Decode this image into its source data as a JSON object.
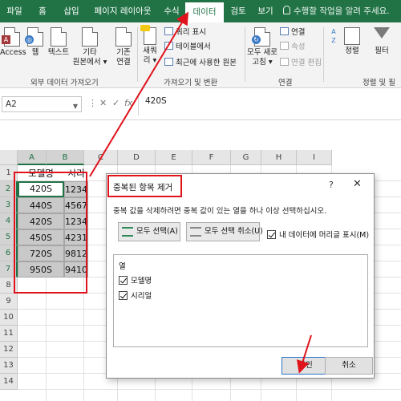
{
  "tabs": [
    "파일",
    "홈",
    "삽입",
    "페이지 레이아웃",
    "수식",
    "데이터",
    "검토",
    "보기"
  ],
  "active_tab": "데이터",
  "tell_me": "수행할 작업을 알려 주세요.",
  "ribbon": {
    "external_data": {
      "access": "Access",
      "web": "웹",
      "text": "텍스트",
      "other_line1": "기타",
      "other_line2": "원본에서 ▾",
      "existing_line1": "기존",
      "existing_line2": "연결",
      "group_label": "외부 데이터 가져오기"
    },
    "get_transform": {
      "new_query_line1": "새쿼",
      "new_query_line2": "리 ▾",
      "show_query": "쿼리 표시",
      "from_table": "테이블에서",
      "recent_sources": "최근에 사용한 원본",
      "group_label": "가져오기 및 변환"
    },
    "connections": {
      "refresh_line1": "모두 새로",
      "refresh_line2": "고침 ▾",
      "connections": "연결",
      "properties": "속성",
      "edit_links": "연결 편집",
      "group_label": "연결"
    },
    "sort_filter": {
      "sort": "정렬",
      "filter": "필터",
      "group_label": "정렬 및 필"
    }
  },
  "formula_bar": {
    "name_box": "A2",
    "cancel": "✕",
    "enter": "✓",
    "fx": "fx",
    "content": "420S"
  },
  "grid": {
    "columns": [
      "A",
      "B",
      "C",
      "D",
      "E",
      "F",
      "G",
      "H",
      "I"
    ],
    "rows": [
      "1",
      "2",
      "3",
      "4",
      "5",
      "6",
      "7",
      "8",
      "9",
      "10",
      "11",
      "12",
      "13",
      "14"
    ],
    "header": [
      "모델명",
      "시리얼"
    ],
    "data": [
      [
        "420S",
        "1234"
      ],
      [
        "440S",
        "4567"
      ],
      [
        "420S",
        "1234"
      ],
      [
        "450S",
        "4231"
      ],
      [
        "720S",
        "9812"
      ],
      [
        "950S",
        "9410"
      ]
    ]
  },
  "dialog": {
    "title": "중복된 항목 제거",
    "help": "?",
    "close": "✕",
    "description": "중복 값을 삭제하려면 중복 값이 있는 열을 하나 이상 선택하십시오.",
    "select_all": "모두 선택(A)",
    "unselect_all": "모두 선택 취소(U)",
    "has_headers": "내 데이터에 머리글 표시(M)",
    "columns_label": "열",
    "columns": [
      "모델명",
      "시리얼"
    ],
    "ok": "확인",
    "cancel": "취소"
  },
  "colors": {
    "excel_green": "#217346",
    "highlight_red": "#e0121b",
    "selection_gray": "#c9c9c9"
  }
}
